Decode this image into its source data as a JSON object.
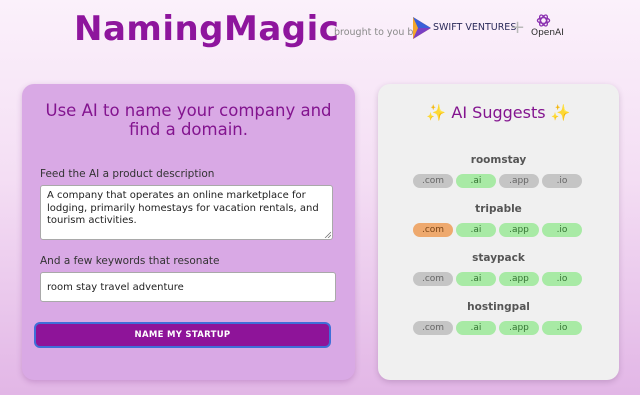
{
  "header": {
    "logo": "NamingMagic",
    "byline": "brought to you by",
    "sponsor1": "SWIFT VENTURES",
    "plus": "+",
    "sponsor2": "OpenAI"
  },
  "form": {
    "title": "Use AI to name your company and find a domain.",
    "description_label": "Feed the AI a product description",
    "description_value": "A company that operates an online marketplace for lodging, primarily homestays for vacation rentals, and tourism activities.",
    "keywords_label": "And a few keywords that resonate",
    "keywords_value": "room stay travel adventure",
    "submit_label": "NAME MY STARTUP"
  },
  "suggestions": {
    "title": "✨ AI Suggests ✨",
    "names": [
      {
        "name": "roomstay",
        "domains": [
          {
            "tld": ".com",
            "status": "taken"
          },
          {
            "tld": ".ai",
            "status": "available"
          },
          {
            "tld": ".app",
            "status": "taken"
          },
          {
            "tld": ".io",
            "status": "taken"
          }
        ]
      },
      {
        "name": "tripable",
        "domains": [
          {
            "tld": ".com",
            "status": "selected"
          },
          {
            "tld": ".ai",
            "status": "available"
          },
          {
            "tld": ".app",
            "status": "available"
          },
          {
            "tld": ".io",
            "status": "available"
          }
        ]
      },
      {
        "name": "staypack",
        "domains": [
          {
            "tld": ".com",
            "status": "taken"
          },
          {
            "tld": ".ai",
            "status": "available"
          },
          {
            "tld": ".app",
            "status": "available"
          },
          {
            "tld": ".io",
            "status": "available"
          }
        ]
      },
      {
        "name": "hostingpal",
        "domains": [
          {
            "tld": ".com",
            "status": "taken"
          },
          {
            "tld": ".ai",
            "status": "available"
          },
          {
            "tld": ".app",
            "status": "available"
          },
          {
            "tld": ".io",
            "status": "available"
          }
        ]
      }
    ]
  },
  "colors": {
    "brand_purple": "#8e159d",
    "taken_pill": "#c5c5c5",
    "available_pill": "#a8eaa5",
    "selected_pill": "#eea96e"
  }
}
